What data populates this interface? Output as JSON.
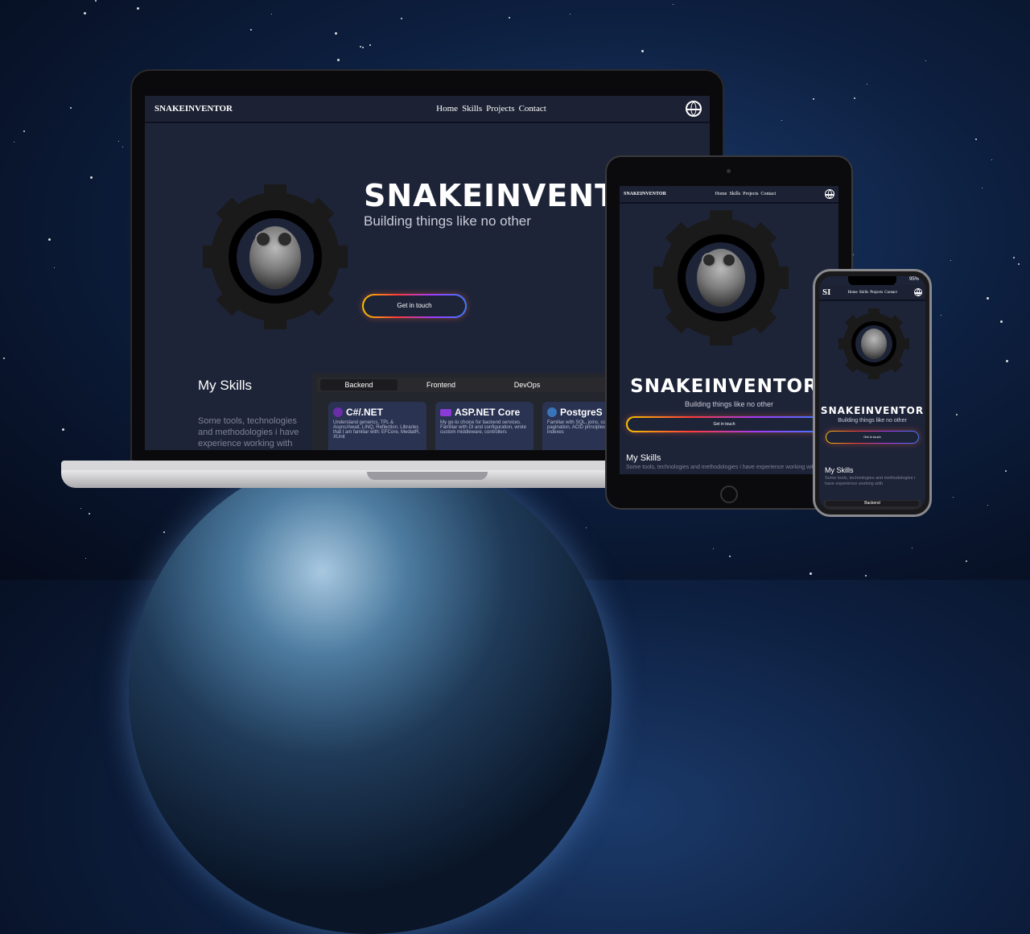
{
  "site": {
    "brand": "SNAKEINVENTOR",
    "brand_short": "SI",
    "nav": [
      "Home",
      "Skills",
      "Projects",
      "Contact"
    ],
    "hero_title": "SNAKEINVENTOR",
    "hero_title_laptop": "SNAKEINVENT",
    "hero_subtitle": "Building things like no other",
    "cta_label": "Get in touch",
    "skills_title": "My Skills",
    "skills_desc": "Some tools, technologies and methodologies i have experience working with",
    "tabs": [
      "Backend",
      "Frontend",
      "DevOps"
    ],
    "cards": [
      {
        "title": "C#/.NET",
        "desc": "Understand generics, TPL & Async/Await, LINQ, Reflection. Libraries that I am familiar with: EFCore, MediatR, XUnit"
      },
      {
        "title": "ASP.NET Core",
        "desc": "My go-to choice for backend services. Familiar with DI and configuration, wrote custom middleware, controllers"
      },
      {
        "title": "PostgreS",
        "desc": "Familiar with SQL, joins, constraints, pagination, ACID principles, optimizing indexes"
      }
    ]
  },
  "phone": {
    "battery": "95%"
  },
  "colors": {
    "page_bg": "#1e2438",
    "nav_bg": "#1c2133",
    "card_bg": "#2a3352",
    "accent_gradient": [
      "#f5c400",
      "#ff3b3b",
      "#a23bff",
      "#3b7bff"
    ]
  }
}
